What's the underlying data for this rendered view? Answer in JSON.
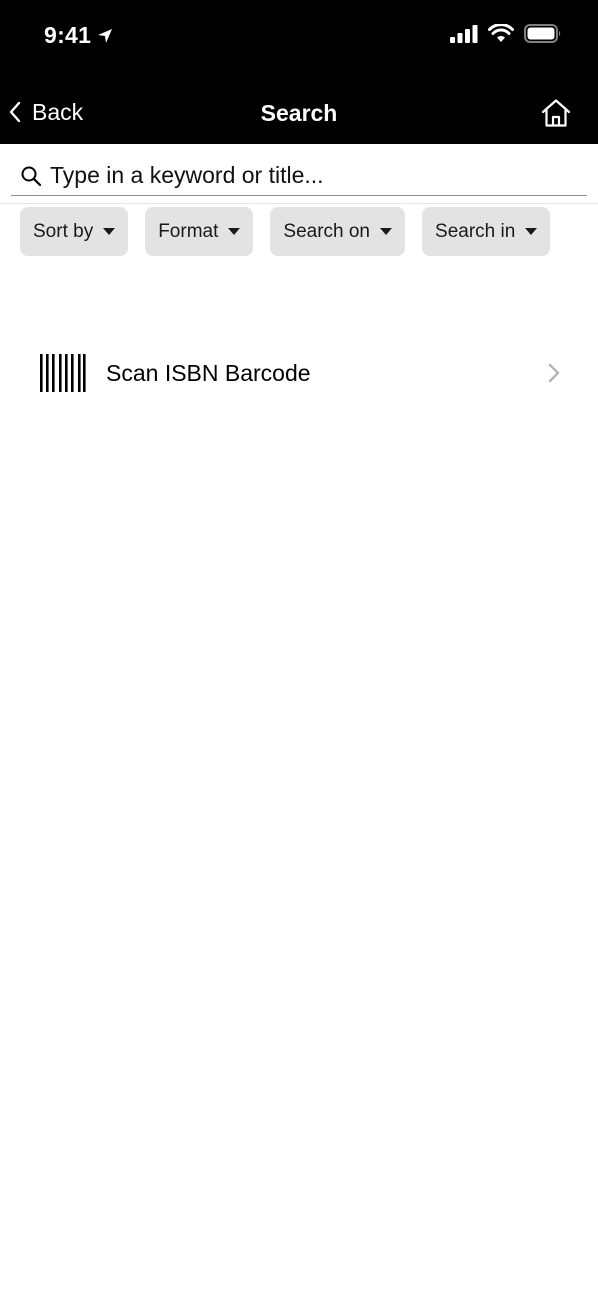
{
  "status_bar": {
    "time": "9:41",
    "icons": [
      "location-arrow-icon",
      "signal-icon",
      "wifi-icon",
      "battery-icon"
    ]
  },
  "nav_bar": {
    "back_label": "Back",
    "title": "Search",
    "icons": [
      "chevron-left-icon",
      "home-icon"
    ]
  },
  "search": {
    "placeholder": "Type in a keyword or title...",
    "value": "",
    "icon": "search-icon"
  },
  "filters": [
    {
      "label": "Sort by"
    },
    {
      "label": "Format"
    },
    {
      "label": "Search on"
    },
    {
      "label": "Search in"
    }
  ],
  "scan": {
    "label": "Scan ISBN Barcode",
    "icons": [
      "barcode-icon",
      "chevron-right-icon"
    ]
  },
  "colors": {
    "header_bg": "#000000",
    "chip_bg": "#e3e3e3",
    "background": "#ffffff"
  }
}
